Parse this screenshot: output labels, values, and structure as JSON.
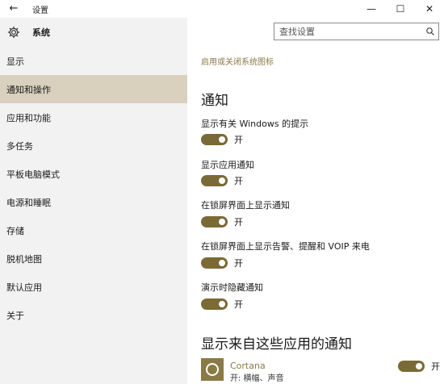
{
  "window": {
    "title": "设置",
    "back_icon": "←",
    "minimize": "—",
    "maximize": "☐",
    "close": "✕"
  },
  "sidebar": {
    "header": "系统",
    "items": [
      {
        "label": "显示"
      },
      {
        "label": "通知和操作",
        "active": true
      },
      {
        "label": "应用和功能"
      },
      {
        "label": "多任务"
      },
      {
        "label": "平板电脑模式"
      },
      {
        "label": "电源和睡眠"
      },
      {
        "label": "存储"
      },
      {
        "label": "脱机地图"
      },
      {
        "label": "默认应用"
      },
      {
        "label": "关于"
      }
    ]
  },
  "search": {
    "placeholder": "查找设置"
  },
  "main": {
    "link": "启用或关闭系统图标",
    "heading": "通知",
    "settings": [
      {
        "label": "显示有关 Windows 的提示",
        "state": "开"
      },
      {
        "label": "显示应用通知",
        "state": "开"
      },
      {
        "label": "在锁屏界面上显示通知",
        "state": "开"
      },
      {
        "label": "在锁屏界面上显示告警、提醒和 VOIP 来电",
        "state": "开"
      },
      {
        "label": "演示时隐藏通知",
        "state": "开"
      }
    ],
    "apps_heading": "显示来自这些应用的通知",
    "apps": [
      {
        "name": "Cortana",
        "desc": "开: 横幅、声音",
        "state": "开"
      }
    ]
  },
  "colors": {
    "accent": "#7a6a35",
    "sidebar_bg": "#f2f2f2",
    "active_bg": "#d9d0bd"
  }
}
